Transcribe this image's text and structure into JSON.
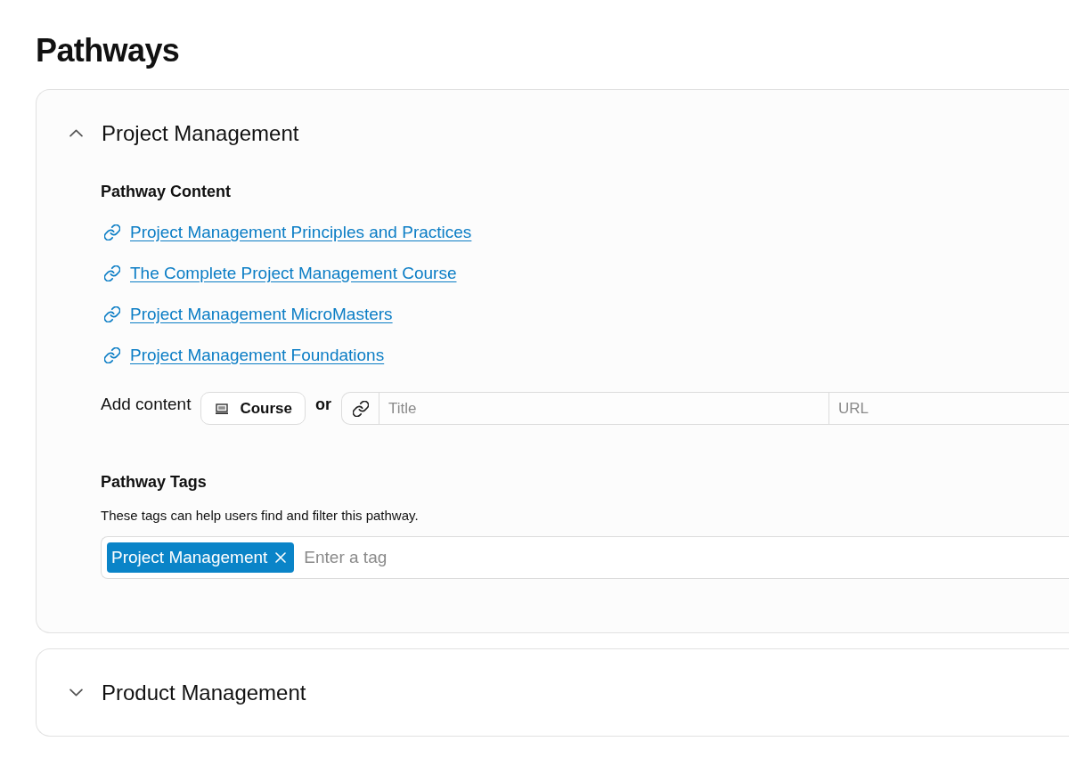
{
  "page": {
    "title": "Pathways"
  },
  "pathways": [
    {
      "title": "Project Management",
      "expanded": true,
      "content": {
        "heading": "Pathway Content",
        "links": [
          {
            "label": "Project Management Principles and Practices"
          },
          {
            "label": "The Complete Project Management Course"
          },
          {
            "label": "Project Management MicroMasters"
          },
          {
            "label": "Project Management Foundations"
          }
        ],
        "add_content": {
          "label": "Add content",
          "course_button": "Course",
          "separator": "or",
          "title_field": {
            "placeholder": "Title"
          },
          "url_field": {
            "placeholder": "URL"
          }
        }
      },
      "tags": {
        "heading": "Pathway Tags",
        "description": "These tags can help users find and filter this pathway.",
        "items": [
          {
            "label": "Project Management"
          }
        ],
        "input": {
          "placeholder": "Enter a tag"
        }
      }
    },
    {
      "title": "Product Management",
      "expanded": false
    }
  ]
}
